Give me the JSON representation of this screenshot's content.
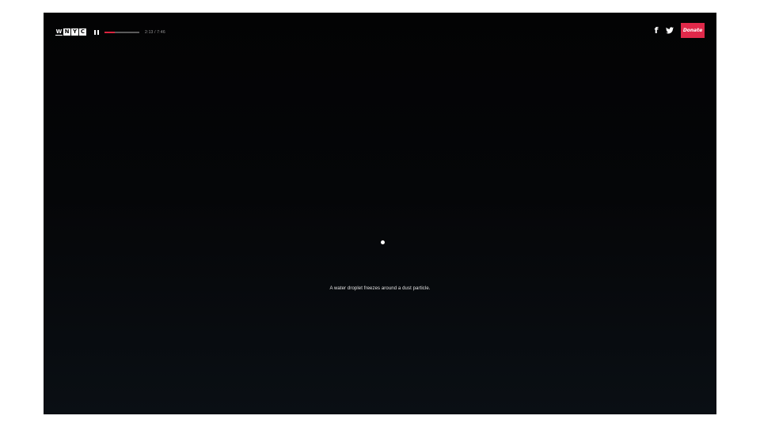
{
  "brand": {
    "logo_letters": [
      "W",
      "N",
      "Y",
      "C"
    ]
  },
  "player": {
    "state": "playing",
    "time_display": "2:13 / 7:46",
    "progress_fraction": 0.29,
    "progress_color": "#d9243f"
  },
  "header": {
    "social": [
      {
        "name": "facebook-icon",
        "glyph": "f"
      },
      {
        "name": "twitter-icon"
      }
    ],
    "donate_label": "Donate",
    "donate_color": "#e0294a"
  },
  "scene": {
    "caption": "A water droplet freezes around a dust particle."
  }
}
